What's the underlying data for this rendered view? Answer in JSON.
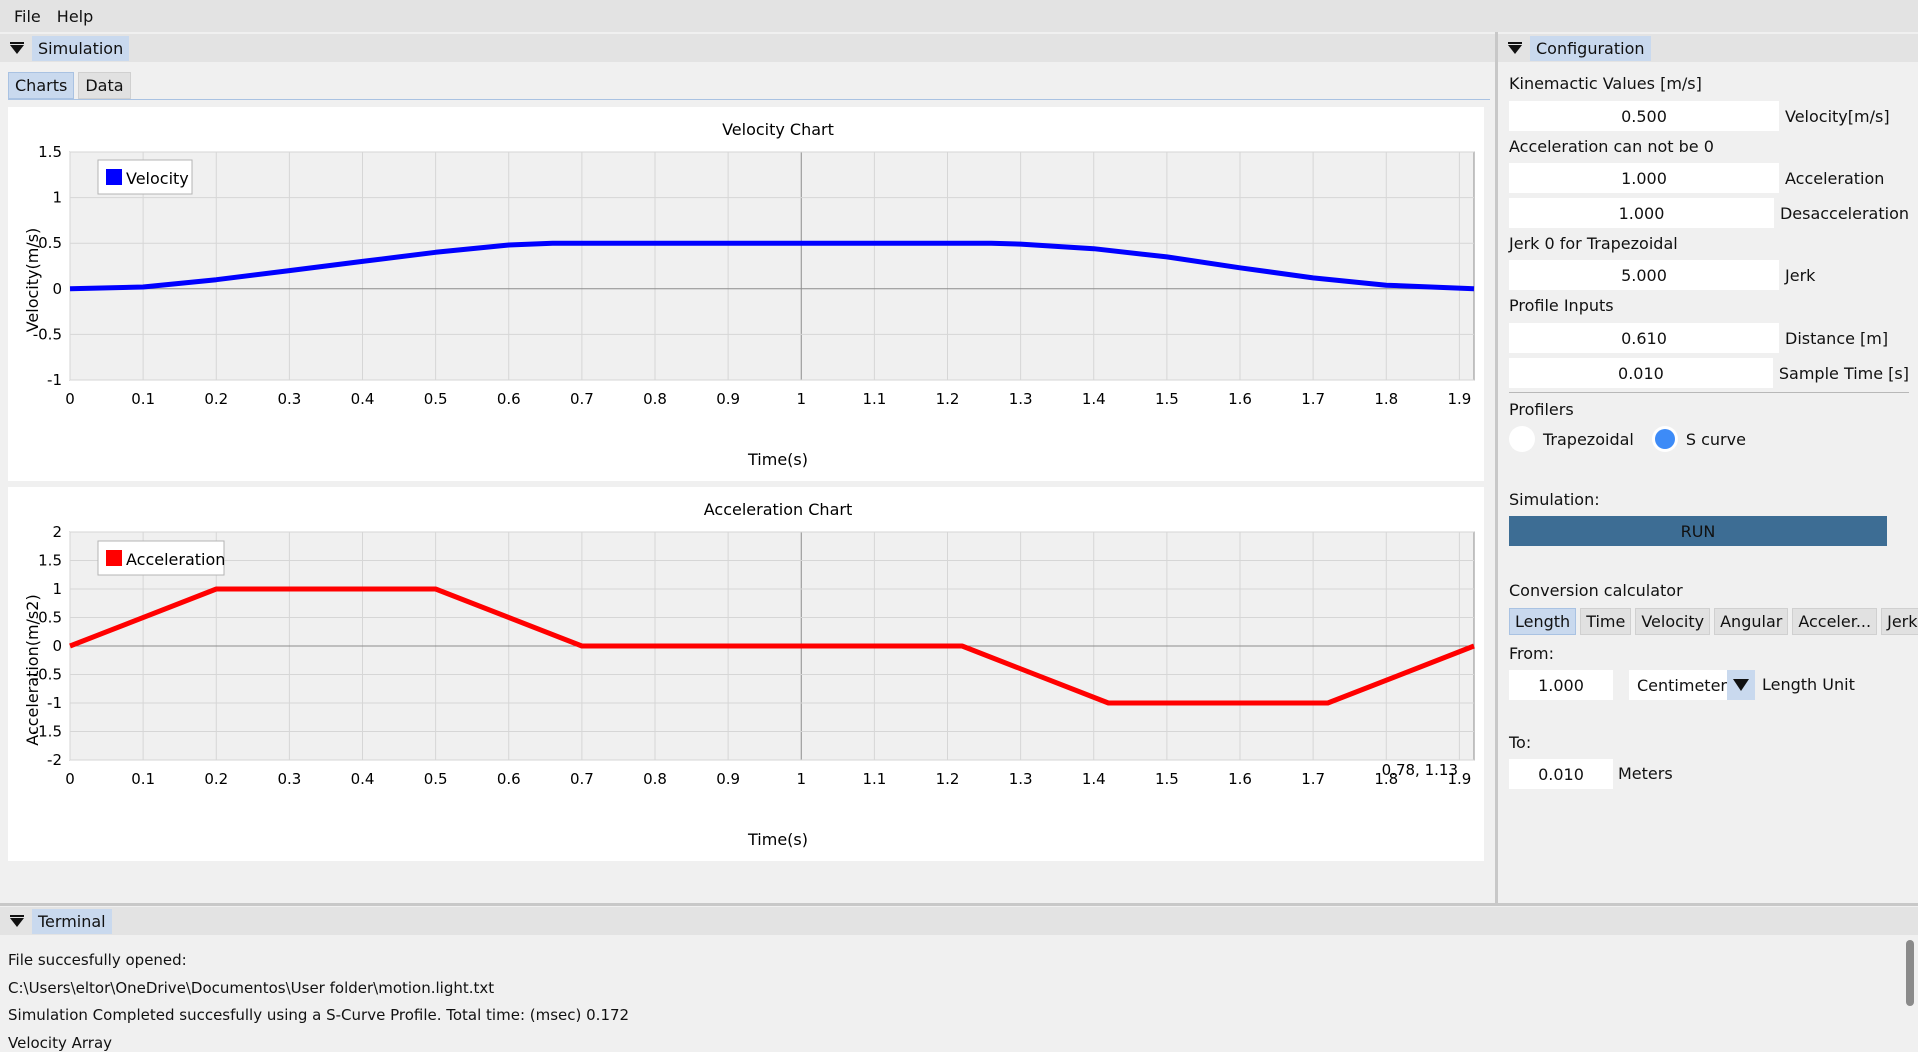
{
  "menu": {
    "items": [
      "File",
      "Help"
    ]
  },
  "simulation": {
    "panel_title": "Simulation",
    "tabs": [
      "Charts",
      "Data"
    ],
    "active_tab": 0
  },
  "velocity_chart": {
    "title": "Velocity Chart",
    "legend": "Velocity",
    "color": "#0000ff"
  },
  "acceleration_chart": {
    "title": "Acceleration Chart",
    "legend": "Acceleration",
    "color": "#ff0000",
    "cursor_readout": "0.78, 1.13"
  },
  "chart_data": [
    {
      "type": "line",
      "title": "Velocity Chart",
      "xlabel": "Time(s)",
      "ylabel": "Velocity(m/s)",
      "xlim": [
        0,
        1.92
      ],
      "ylim": [
        -1,
        1.5
      ],
      "xticks": [
        0,
        0.1,
        0.2,
        0.3,
        0.4,
        0.5,
        0.6,
        0.7,
        0.8,
        0.9,
        1,
        1.1,
        1.2,
        1.3,
        1.4,
        1.5,
        1.6,
        1.7,
        1.8,
        1.9
      ],
      "yticks": [
        -1,
        -0.5,
        0,
        0.5,
        1,
        1.5
      ],
      "grid": true,
      "legend_position": "top-left",
      "series": [
        {
          "name": "Velocity",
          "color": "#0000ff",
          "x": [
            0,
            0.1,
            0.2,
            0.3,
            0.4,
            0.5,
            0.6,
            0.66,
            0.7,
            0.8,
            0.9,
            1.0,
            1.1,
            1.2,
            1.26,
            1.3,
            1.4,
            1.5,
            1.6,
            1.7,
            1.8,
            1.92
          ],
          "y": [
            0,
            0.02,
            0.1,
            0.2,
            0.3,
            0.4,
            0.48,
            0.5,
            0.5,
            0.5,
            0.5,
            0.5,
            0.5,
            0.5,
            0.5,
            0.49,
            0.44,
            0.35,
            0.23,
            0.12,
            0.04,
            0
          ]
        }
      ]
    },
    {
      "type": "line",
      "title": "Acceleration Chart",
      "xlabel": "Time(s)",
      "ylabel": "Acceleration(m/s2)",
      "xlim": [
        0,
        1.92
      ],
      "ylim": [
        -2,
        2
      ],
      "xticks": [
        0,
        0.1,
        0.2,
        0.3,
        0.4,
        0.5,
        0.6,
        0.7,
        0.8,
        0.9,
        1,
        1.1,
        1.2,
        1.3,
        1.4,
        1.5,
        1.6,
        1.7,
        1.8,
        1.9
      ],
      "yticks": [
        -2,
        -1.5,
        -1,
        -0.5,
        0,
        0.5,
        1,
        1.5,
        2
      ],
      "grid": true,
      "legend_position": "top-left",
      "series": [
        {
          "name": "Acceleration",
          "color": "#ff0000",
          "x": [
            0,
            0.2,
            0.5,
            0.7,
            1.22,
            1.42,
            1.72,
            1.92
          ],
          "y": [
            0,
            1,
            1,
            0,
            0,
            -1,
            -1,
            0
          ]
        }
      ]
    }
  ],
  "configuration": {
    "panel_title": "Configuration",
    "kinematic_label": "Kinemactic Values [m/s]",
    "velocity_value": "0.500",
    "velocity_unit": "Velocity[m/s]",
    "accel_note": "Acceleration can not be 0",
    "acceleration_value": "1.000",
    "acceleration_unit": "Acceleration",
    "deceleration_value": "1.000",
    "deceleration_unit": "Desacceleration",
    "jerk_note": "Jerk 0 for Trapezoidal",
    "jerk_value": "5.000",
    "jerk_unit": "Jerk",
    "profile_inputs_label": "Profile Inputs",
    "distance_value": "0.610",
    "distance_unit": "Distance [m]",
    "sample_time_value": "0.010",
    "sample_time_unit": "Sample Time [s]",
    "profilers_label": "Profilers",
    "profiler_options": [
      "Trapezoidal",
      "S curve"
    ],
    "selected_profiler": "S curve",
    "simulation_label": "Simulation:",
    "run_label": "RUN"
  },
  "conversion": {
    "label": "Conversion calculator",
    "tabs": [
      "Length",
      "Time",
      "Velocity",
      "Angular",
      "Acceler...",
      "Jerk"
    ],
    "active_tab": 0,
    "from_label": "From:",
    "from_value": "1.000",
    "from_unit_selected": "Centimeter",
    "from_unit_caption": "Length Unit",
    "to_label": "To:",
    "to_value": "0.010",
    "to_unit": "Meters"
  },
  "terminal": {
    "panel_title": "Terminal",
    "lines": [
      "File succesfully opened:",
      "C:\\Users\\eltor\\OneDrive\\Documentos\\User folder\\motion.light.txt",
      "Simulation Completed succesfully using a S-Curve Profile.   Total time: (msec) 0.172",
      "Velocity Array"
    ]
  }
}
